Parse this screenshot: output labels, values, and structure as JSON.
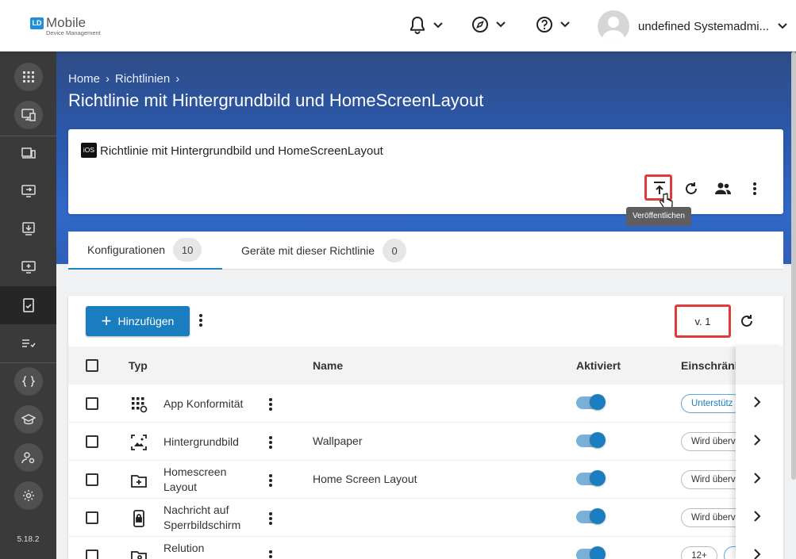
{
  "topbar": {
    "logo_badge": "LD",
    "logo_main": "Mobile",
    "logo_sub": "Device Management",
    "user_name": "undefined Systemadmi..."
  },
  "sidebar": {
    "version": "5.18.2",
    "items": [
      "apps-icon",
      "device-monitor-icon",
      "devices-icon",
      "screen-share-icon",
      "download-icon",
      "add-screen-icon",
      "policy-icon",
      "checklist-icon",
      "code-braces-icon",
      "school-icon",
      "user-settings-icon",
      "settings-icon"
    ]
  },
  "breadcrumb": {
    "home": "Home",
    "policies": "Richtlinien"
  },
  "page_title": "Richtlinie mit Hintergrundbild und HomeScreenLayout",
  "card": {
    "platform_badge": "iOS",
    "title": "Richtlinie mit Hintergrundbild und HomeScreenLayout",
    "tooltip": "Veröffentlichen"
  },
  "tabs": [
    {
      "label": "Konfigurationen",
      "count": "10"
    },
    {
      "label": "Geräte mit dieser Richtlinie",
      "count": "0"
    }
  ],
  "toolbar": {
    "add_label": "Hinzufügen",
    "version": "v. 1"
  },
  "table": {
    "headers": {
      "type": "Typ",
      "name": "Name",
      "enabled": "Aktiviert",
      "restrictions": "Einschränk"
    },
    "rows": [
      {
        "type": "App Konformität",
        "name": "",
        "chip": "Unterstütz"
      },
      {
        "type": "Hintergrundbild",
        "name": "Wallpaper",
        "chip": "Wird überv"
      },
      {
        "type_line1": "Homescreen",
        "type_line2": "Layout",
        "name": "Home Screen Layout",
        "chip": "Wird überv"
      },
      {
        "type_line1": "Nachricht auf",
        "type_line2": "Sperrbildschirm",
        "name": "",
        "chip": "Wird überv"
      },
      {
        "type_line1": "Relution",
        "name": "",
        "chip": "12+"
      }
    ]
  }
}
